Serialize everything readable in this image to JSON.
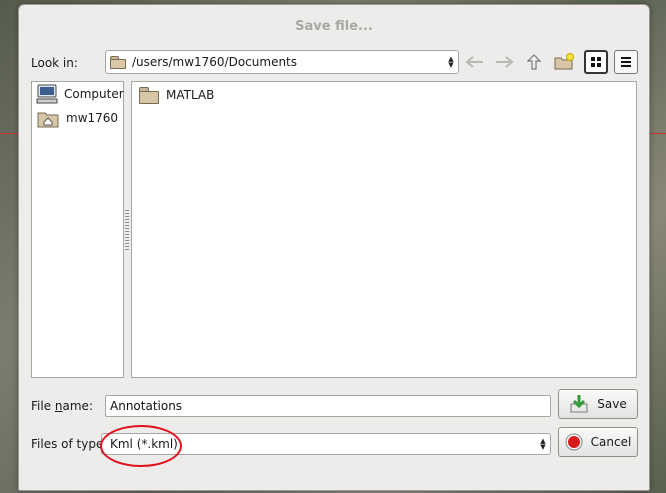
{
  "dialog": {
    "title": "Save file..."
  },
  "lookin": {
    "label": "Look in:",
    "path": "/users/mw1760/Documents",
    "folder_icon": "folder-icon"
  },
  "toolbar": {
    "back_icon": "back-arrow-icon",
    "forward_icon": "forward-arrow-icon",
    "up_icon": "parent-directory-icon",
    "new_folder_icon": "new-folder-icon",
    "icon_view_icon": "icon-view-icon",
    "detail_view_icon": "detail-view-icon"
  },
  "places": [
    {
      "label": "Computer",
      "icon": "computer-icon"
    },
    {
      "label": "mw1760",
      "icon": "home-folder-icon"
    }
  ],
  "files": [
    {
      "name": "MATLAB",
      "icon": "folder-icon"
    }
  ],
  "filename": {
    "label": "File name:",
    "value": "Annotations"
  },
  "filetype": {
    "label": "Files of type:",
    "value": "Kml (*.kml)"
  },
  "buttons": {
    "save": "Save",
    "cancel": "Cancel"
  },
  "colors": {
    "annotation": "#e0121e",
    "dialog_bg": "#edeceb"
  }
}
